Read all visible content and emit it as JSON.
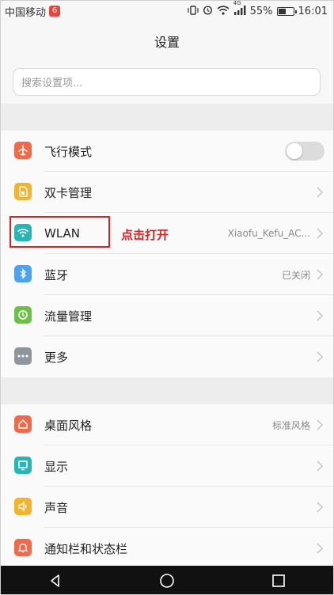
{
  "status_bar": {
    "carrier": "中国移动",
    "network_type": "4G",
    "battery_percent": "55%",
    "battery_level": 0.55,
    "time": "16:01"
  },
  "title": "设置",
  "search": {
    "placeholder": "搜索设置项..."
  },
  "group1": [
    {
      "label": "飞行模式",
      "icon": "airplane-icon",
      "color": "#f06a4a",
      "toggle": false
    },
    {
      "label": "双卡管理",
      "icon": "sim-card-icon",
      "color": "#f5b32c"
    },
    {
      "label": "WLAN",
      "icon": "wifi-icon",
      "color": "#27b5b5",
      "value": "Xiaofu_Kefu_AC..."
    },
    {
      "label": "蓝牙",
      "icon": "bluetooth-icon",
      "color": "#4aa3ec",
      "value": "已关闭"
    },
    {
      "label": "流量管理",
      "icon": "data-usage-icon",
      "color": "#6cc04a"
    },
    {
      "label": "更多",
      "icon": "more-icon",
      "color": "#8f959c"
    }
  ],
  "group2": [
    {
      "label": "桌面风格",
      "icon": "home-icon",
      "color": "#f06a4a",
      "value": "标准风格"
    },
    {
      "label": "显示",
      "icon": "display-icon",
      "color": "#27b5b5"
    },
    {
      "label": "声音",
      "icon": "sound-icon",
      "color": "#f5b32c"
    },
    {
      "label": "通知栏和状态栏",
      "icon": "bell-icon",
      "color": "#f06a4a"
    }
  ],
  "annotation": "点击打开",
  "colors": {
    "annotation_red": "#e02020"
  }
}
